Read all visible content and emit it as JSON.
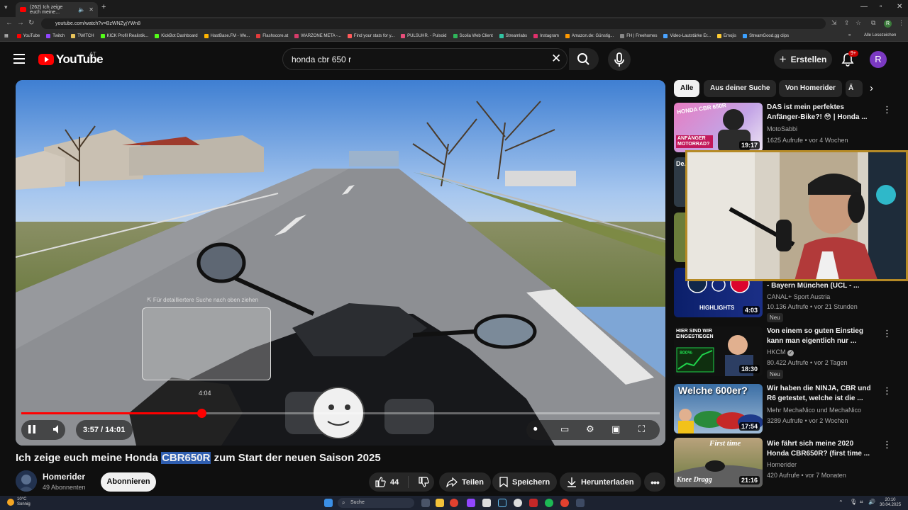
{
  "browser": {
    "tab_title": "(262) Ich zeige euch meine...",
    "url": "youtube.com/watch?v=BzWNZyjYWn8",
    "bookmarks": [
      {
        "label": "YouTube",
        "color": "#ff0000"
      },
      {
        "label": "Twitch",
        "color": "#9146ff"
      },
      {
        "label": "TWITCH",
        "color": "#e8c35a"
      },
      {
        "label": "KICK Profil Realistik...",
        "color": "#53fc18"
      },
      {
        "label": "KickBot Dashboard",
        "color": "#53fc18"
      },
      {
        "label": "HastBase.FM - We...",
        "color": "#ffb400"
      },
      {
        "label": "Flashscore.at",
        "color": "#e23b3b"
      },
      {
        "label": "WARZONE META -...",
        "color": "#d63c6a"
      },
      {
        "label": "Find your stats for y...",
        "color": "#ff5a5a"
      },
      {
        "label": "PULSUHR. - Pulsoid",
        "color": "#e84d7a"
      },
      {
        "label": "Scolia Web Client",
        "color": "#2fb55a"
      },
      {
        "label": "Streamlabs",
        "color": "#31c3a2"
      },
      {
        "label": "Instagram",
        "color": "#e1306c"
      },
      {
        "label": "Amazon.de: Günstig...",
        "color": "#ff9900"
      },
      {
        "label": "FH | Freehomes",
        "color": "#888888"
      },
      {
        "label": "Video-Lautstärke Er...",
        "color": "#4aa3ff"
      },
      {
        "label": "Emojis",
        "color": "#ffcc33"
      },
      {
        "label": "StreamGood.gg clips",
        "color": "#3ba0ff"
      }
    ],
    "all_bookmarks": "Alle Lesezeichen"
  },
  "header": {
    "logo": "YouTube",
    "country": "AT",
    "search_query": "honda cbr 650 r",
    "create_label": "Erstellen",
    "notif_count": "9+",
    "avatar_letter": "R"
  },
  "player": {
    "hover_hint": "⇱ Für detailliertere Suche nach oben ziehen",
    "preview_time": "4:04",
    "current_time": "3:57 / 14:01",
    "progress": 0.282
  },
  "video": {
    "title_before": "Ich zeige euch meine Honda ",
    "title_highlight": "CBR650R",
    "title_after": " zum Start der neuen Saison 2025",
    "channel": "Homerider",
    "subscribers": "49 Abonnenten",
    "subscribe_label": "Abonnieren",
    "likes": "44",
    "share": "Teilen",
    "save": "Speichern",
    "download": "Herunterladen"
  },
  "chips": [
    "Alle",
    "Aus deiner Suche",
    "Von Homerider",
    "Ä"
  ],
  "recommendations": [
    {
      "title": "DAS ist mein perfektes Anfänger-Bike?! 😳 | Honda ...",
      "channel": "MotoSabbi",
      "meta": "1625 Aufrufe • vor 4 Wochen",
      "duration": "19:17",
      "badge": ""
    },
    {
      "title": "De...",
      "channel": "",
      "meta": "",
      "duration": "",
      "badge": ""
    },
    {
      "title": "- Bayern München (UCL - ...",
      "channel": "CANAL+ Sport Austria",
      "meta": "10.136 Aufrufe • vor 21 Stunden",
      "duration": "4:03",
      "badge": "Neu"
    },
    {
      "title": "Von einem so guten Einstieg kann man eigentlich nur ...",
      "channel": "HKCM",
      "meta": "80.422 Aufrufe • vor 2 Tagen",
      "duration": "18:30",
      "badge": "Neu"
    },
    {
      "title": "Wir haben die NINJA, CBR und R6 getestet, welche ist die ...",
      "channel": "Mehr MechaNico und MechaNico",
      "meta": "3289 Aufrufe • vor 2 Wochen",
      "duration": "17:54",
      "badge": ""
    },
    {
      "title": "Wie fährt sich meine 2020 Honda CBR650R? (first time ...",
      "channel": "Homerider",
      "meta": "420 Aufrufe • vor 7 Monaten",
      "duration": "21:16",
      "badge": ""
    }
  ],
  "thumb_text": {
    "r1": "ANFÄNGER MOTORRAD?",
    "r1b": "HONDA CBR 650R",
    "r3": "HIGHLIGHTS",
    "r4": "HIER SIND WIR EINGESTIEGEN",
    "r4b": "800%",
    "r5": "Welche 600er?",
    "r6a": "First time",
    "r6b": "Knee Dragg"
  },
  "taskbar": {
    "temp": "10°C",
    "weather": "Sonnig",
    "search": "Suche",
    "time": "20:10",
    "date": "30.04.2025"
  }
}
